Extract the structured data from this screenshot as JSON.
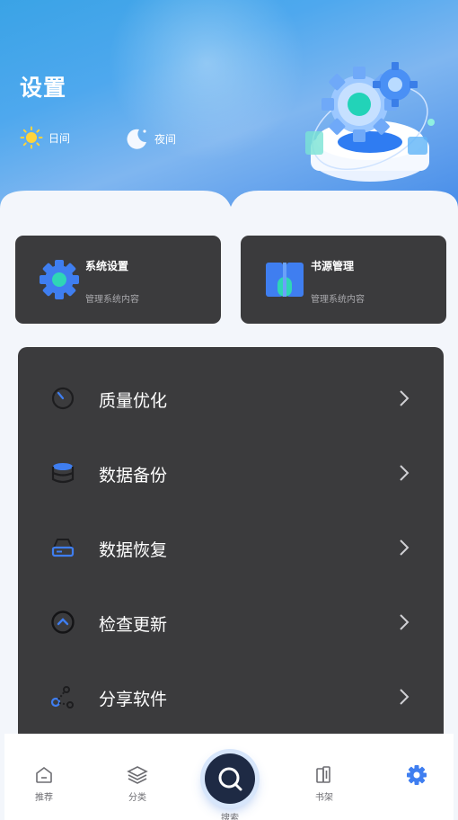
{
  "header": {
    "title": "设置",
    "modes": {
      "day": "日间",
      "night": "夜间"
    }
  },
  "cards": [
    {
      "title": "系统设置",
      "subtitle": "管理系统内容",
      "icon": "gear-icon"
    },
    {
      "title": "书源管理",
      "subtitle": "管理系统内容",
      "icon": "book-source-icon"
    }
  ],
  "menu": {
    "items": [
      {
        "label": "质量优化",
        "icon": "speed-gauge-icon"
      },
      {
        "label": "数据备份",
        "icon": "database-icon"
      },
      {
        "label": "数据恢复",
        "icon": "hard-drive-icon"
      },
      {
        "label": "检查更新",
        "icon": "update-chevron-icon"
      },
      {
        "label": "分享软件",
        "icon": "share-icon"
      }
    ]
  },
  "tabbar": {
    "items": [
      {
        "label": "推荐",
        "icon": "home-icon"
      },
      {
        "label": "分类",
        "icon": "layers-icon"
      },
      {
        "label": "搜索",
        "icon": "search-icon"
      },
      {
        "label": "书架",
        "icon": "bookshelf-icon"
      },
      {
        "label": "",
        "icon": "settings-icon",
        "active": true
      }
    ]
  },
  "colors": {
    "accent": "#3f7ef0",
    "hero_blue": "#4ea8ee",
    "card_bg": "#3b3b3d",
    "page_bg": "#f3f6fb"
  }
}
